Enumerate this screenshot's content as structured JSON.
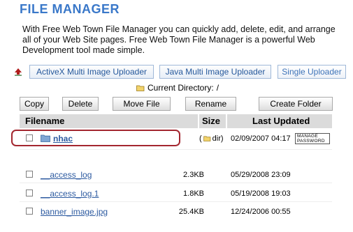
{
  "page": {
    "title": "FILE MANAGER",
    "intro": "With Free Web Town File Manager you can quickly add, delete, edit, and arrange all of your Web Site pages. Free Web Town File Manager is a powerful Web Development tool made simple."
  },
  "uploaders": {
    "activex": "ActiveX Multi Image Uploader",
    "java": "Java Multi Image Uploader",
    "single": "Single Uploader"
  },
  "current_directory": {
    "label": "Current Directory:",
    "value": "/"
  },
  "actions": {
    "copy": "Copy",
    "delete": "Delete",
    "move": "Move File",
    "rename": "Rename",
    "create_folder": "Create Folder"
  },
  "table": {
    "headers": {
      "filename": "Filename",
      "size": "Size",
      "last_updated": "Last Updated"
    },
    "rows": [
      {
        "name": "nhac",
        "size": "dir)",
        "date": "02/09/2007 04:17",
        "manage": "MANAGE PASSWORD"
      },
      {
        "name": "__access_log",
        "size": "2.3KB",
        "date": "05/29/2008 23:09"
      },
      {
        "name": "__access_log.1",
        "size": "1.8KB",
        "date": "05/19/2008 19:03"
      },
      {
        "name": "banner_image.jpg",
        "size": "25.4KB",
        "date": "12/24/2006 00:55"
      }
    ]
  },
  "colors": {
    "title": "#3a78c9",
    "link": "#2c5aa0",
    "highlight": "#a3262f",
    "folder": "#f2d36b"
  }
}
